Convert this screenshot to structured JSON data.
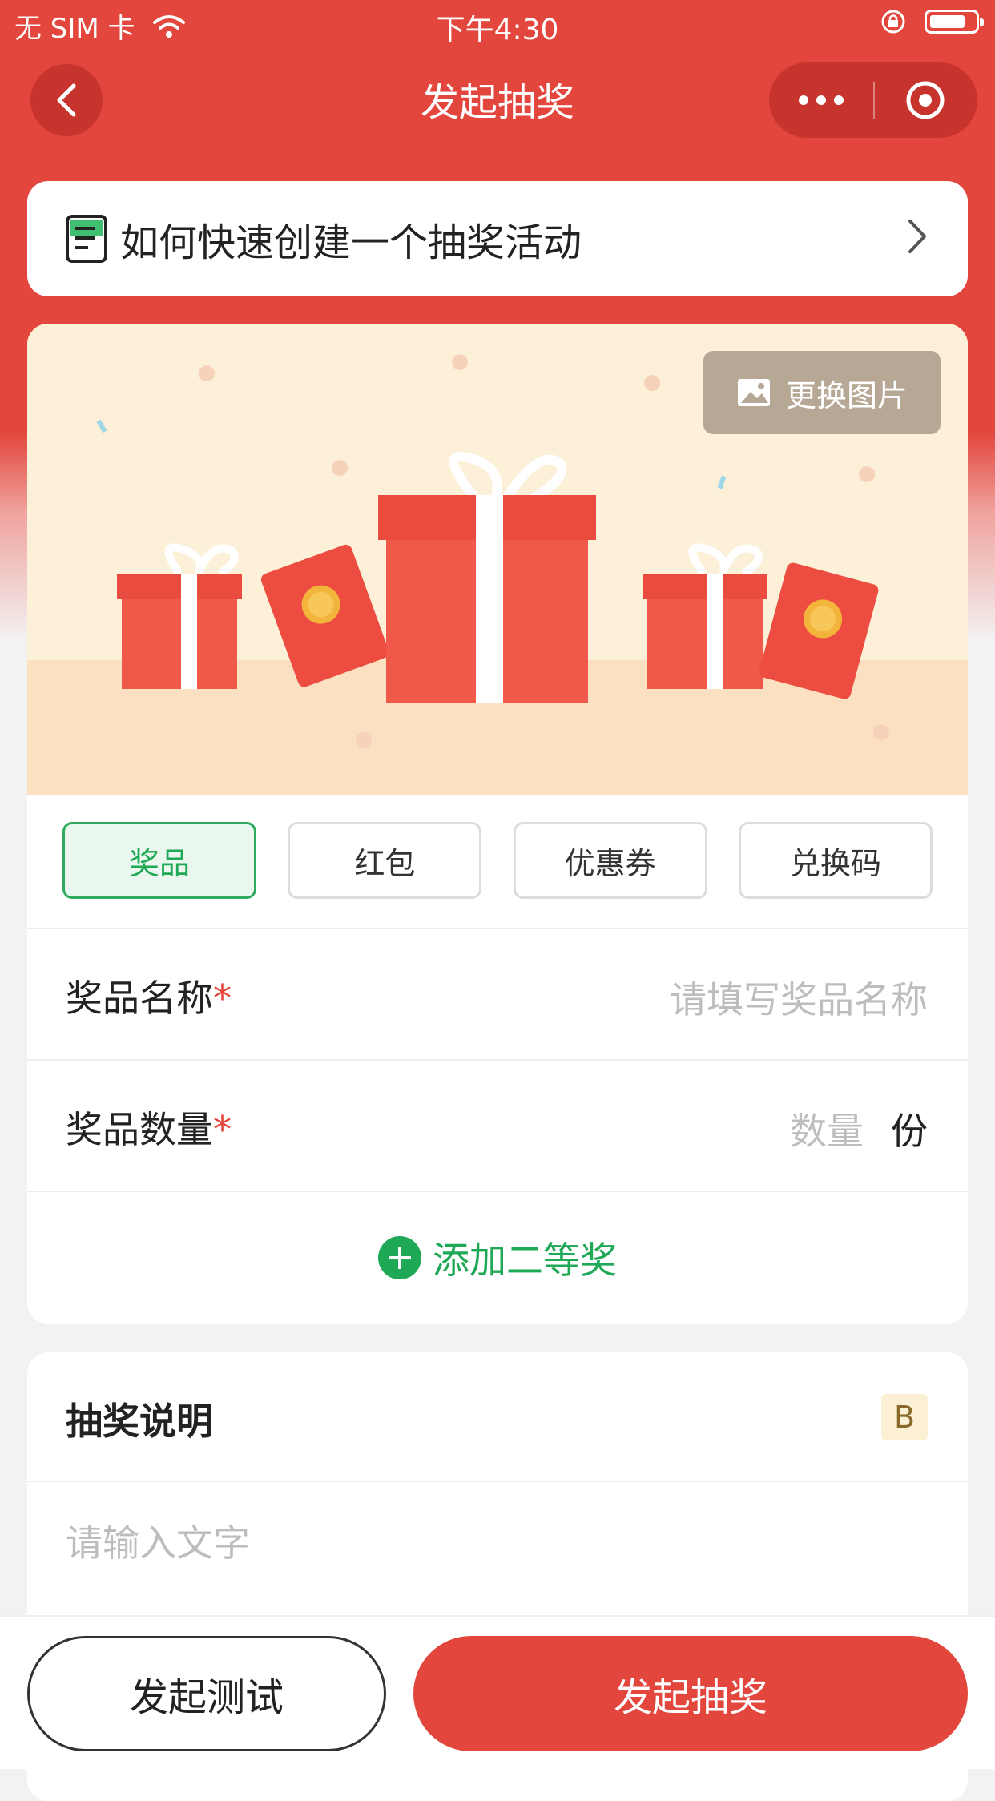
{
  "status_bar": {
    "carrier": "无 SIM 卡",
    "time": "下午4:30",
    "battery_level": 0.8
  },
  "nav": {
    "title": "发起抽奖"
  },
  "guide": {
    "text": "如何快速创建一个抽奖活动"
  },
  "banner": {
    "change_image_label": "更换图片"
  },
  "prize_tabs": [
    {
      "label": "奖品",
      "active": true
    },
    {
      "label": "红包",
      "active": false
    },
    {
      "label": "优惠券",
      "active": false
    },
    {
      "label": "兑换码",
      "active": false
    }
  ],
  "form": {
    "prize_name_label": "奖品名称",
    "prize_name_placeholder": "请填写奖品名称",
    "prize_qty_label": "奖品数量",
    "prize_qty_placeholder": "数量",
    "prize_qty_unit": "份",
    "required_mark": "*",
    "add_prize_label": "添加二等奖"
  },
  "description": {
    "title": "抽奖说明",
    "format_button": "B",
    "placeholder": "请输入文字"
  },
  "footer": {
    "test_label": "发起测试",
    "launch_label": "发起抽奖"
  },
  "colors": {
    "primary_red": "#e2463c",
    "accent_green": "#1fa856"
  }
}
